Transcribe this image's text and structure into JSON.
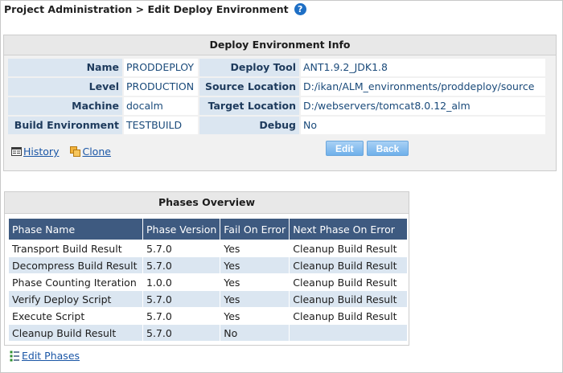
{
  "breadcrumb": "Project Administration > Edit Deploy Environment",
  "help_glyph": "?",
  "info_panel": {
    "title": "Deploy Environment Info",
    "rows": [
      {
        "label1": "Name",
        "value1": "PRODDEPLOY",
        "label2": "Deploy Tool",
        "value2": "ANT1.9.2_JDK1.8"
      },
      {
        "label1": "Level",
        "value1": "PRODUCTION",
        "label2": "Source Location",
        "value2": "D:/ikan/ALM_environments/proddeploy/source"
      },
      {
        "label1": "Machine",
        "value1": "docalm",
        "label2": "Target Location",
        "value2": "D:/webservers/tomcat8.0.12_alm"
      },
      {
        "label1": "Build Environment",
        "value1": "TESTBUILD",
        "label2": "Debug",
        "value2": "No"
      }
    ],
    "history_link": "History",
    "clone_link": "Clone",
    "edit_button": "Edit",
    "back_button": "Back"
  },
  "phases_panel": {
    "title": "Phases Overview",
    "headers": [
      "Phase Name",
      "Phase Version",
      "Fail On Error",
      "Next Phase On Error"
    ],
    "rows": [
      [
        "Transport Build Result",
        "5.7.0",
        "Yes",
        "Cleanup Build Result"
      ],
      [
        "Decompress Build Result",
        "5.7.0",
        "Yes",
        "Cleanup Build Result"
      ],
      [
        "Phase Counting Iteration",
        "1.0.0",
        "Yes",
        "Cleanup Build Result"
      ],
      [
        "Verify Deploy Script",
        "5.7.0",
        "Yes",
        "Cleanup Build Result"
      ],
      [
        "Execute Script",
        "5.7.0",
        "Yes",
        "Cleanup Build Result"
      ],
      [
        "Cleanup Build Result",
        "5.7.0",
        "No",
        ""
      ]
    ]
  },
  "edit_phases_link": "Edit Phases",
  "colors": {
    "accent": "#3e5a80",
    "label_bg": "#dbe6f1",
    "button": "#6fb0ea",
    "link": "#1a56a6"
  },
  "icons": [
    "help-icon",
    "history-icon",
    "clone-icon",
    "edit-phases-icon"
  ]
}
